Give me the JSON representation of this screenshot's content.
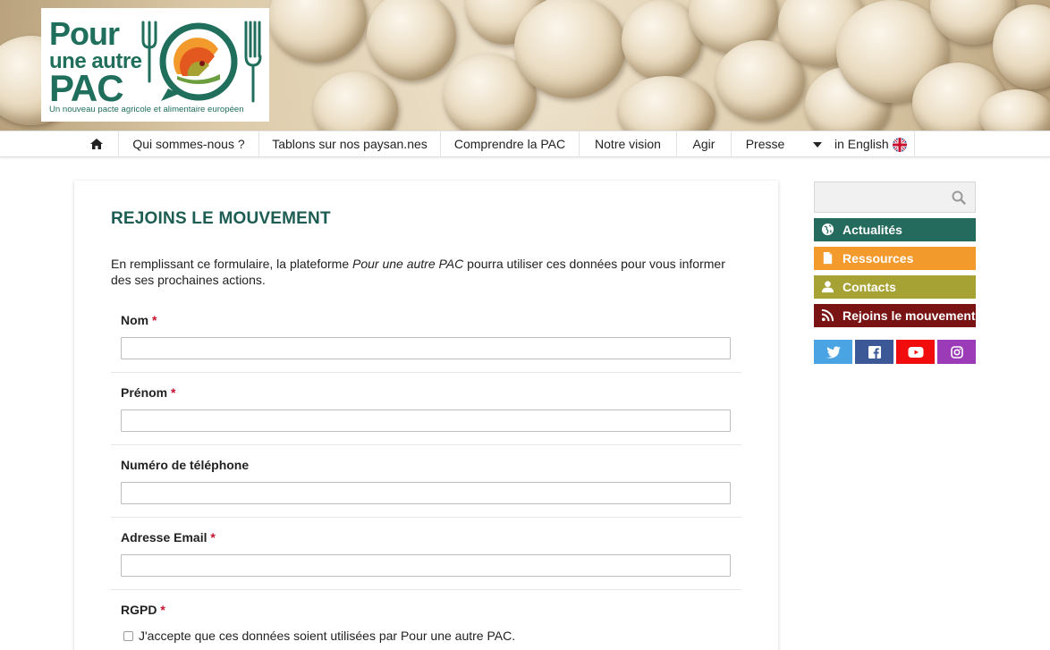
{
  "logo": {
    "line1": "Pour",
    "line2": "une autre",
    "line3": "PAC",
    "tagline": "Un nouveau pacte agricole et alimentaire européen"
  },
  "nav": {
    "home_icon": "home-icon",
    "items": [
      "Qui sommes-nous ?",
      "Tablons sur nos paysan.nes",
      "Comprendre la PAC",
      "Notre vision",
      "Agir",
      "Presse"
    ],
    "language": "in English"
  },
  "form": {
    "title": "REJOINS LE MOUVEMENT",
    "intro_before": "En remplissant ce formulaire, la plateforme ",
    "intro_em": "Pour une autre PAC",
    "intro_after": " pourra utiliser ces données pour vous informer des ses prochaines actions.",
    "required_marker": "*",
    "fields": [
      {
        "label": "Nom",
        "required": true,
        "value": ""
      },
      {
        "label": "Prénom",
        "required": true,
        "value": ""
      },
      {
        "label": "Numéro de téléphone",
        "required": false,
        "value": ""
      },
      {
        "label": "Adresse Email",
        "required": true,
        "value": ""
      }
    ],
    "rgpd_label": "RGPD",
    "rgpd_checkbox": "J'accepte que ces données soient utilisées par Pour une autre PAC."
  },
  "sidebar": {
    "search_placeholder": "",
    "buttons": [
      {
        "label": "Actualités",
        "icon": "globe-icon",
        "color": "#246b5e"
      },
      {
        "label": "Ressources",
        "icon": "document-icon",
        "color": "#f39a2d"
      },
      {
        "label": "Contacts",
        "icon": "user-icon",
        "color": "#a7a234"
      },
      {
        "label": "Rejoins le mouvement",
        "icon": "rss-icon",
        "color": "#7a1414"
      }
    ],
    "social": [
      {
        "name": "twitter-icon",
        "color": "#4aa4e3"
      },
      {
        "name": "facebook-icon",
        "color": "#3c5896"
      },
      {
        "name": "youtube-icon",
        "color": "#f10d0d"
      },
      {
        "name": "instagram-icon",
        "color": "#9c3bb8"
      }
    ]
  },
  "colors": {
    "brand_green": "#1f6f5c",
    "title_green": "#1d5c52",
    "required_red": "#c8102e"
  }
}
